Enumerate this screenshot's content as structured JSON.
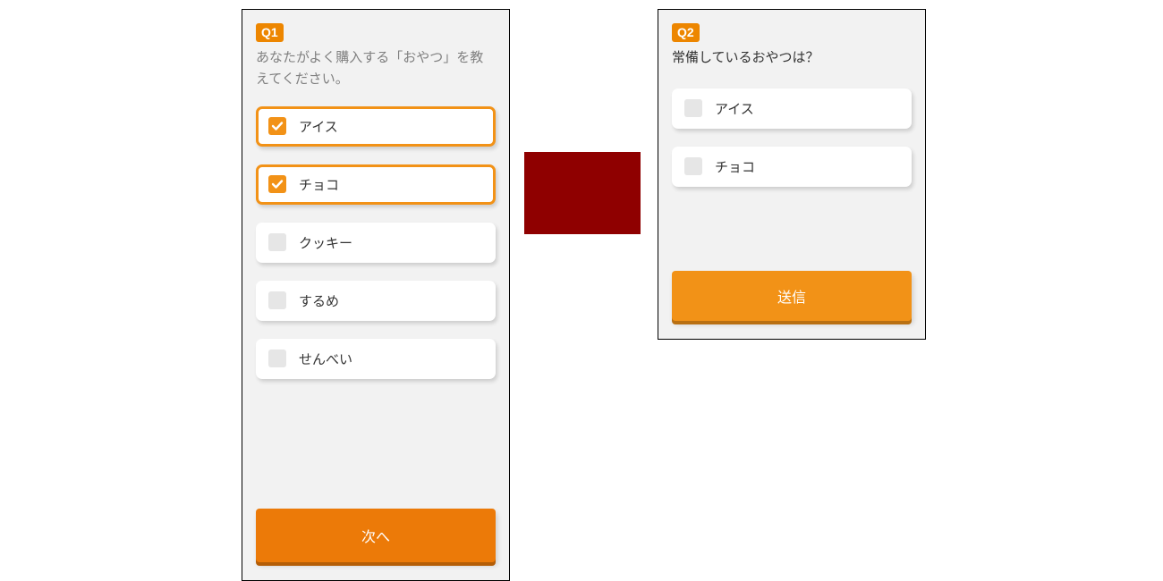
{
  "q1": {
    "badge": "Q1",
    "prompt": "あなたがよく購入する「おやつ」を教えてください。",
    "options": [
      {
        "label": "アイス",
        "selected": true
      },
      {
        "label": "チョコ",
        "selected": true
      },
      {
        "label": "クッキー",
        "selected": false
      },
      {
        "label": "するめ",
        "selected": false
      },
      {
        "label": "せんべい",
        "selected": false
      }
    ],
    "button": "次へ"
  },
  "q2": {
    "badge": "Q2",
    "prompt": "常備しているおやつは？",
    "options": [
      {
        "label": "アイス",
        "selected": false
      },
      {
        "label": "チョコ",
        "selected": false
      }
    ],
    "button": "送信"
  },
  "colors": {
    "accent": "#f29217",
    "primary_button": "#ec7a08",
    "center_block": "#8f0000",
    "panel_bg": "#f2f2f2"
  }
}
